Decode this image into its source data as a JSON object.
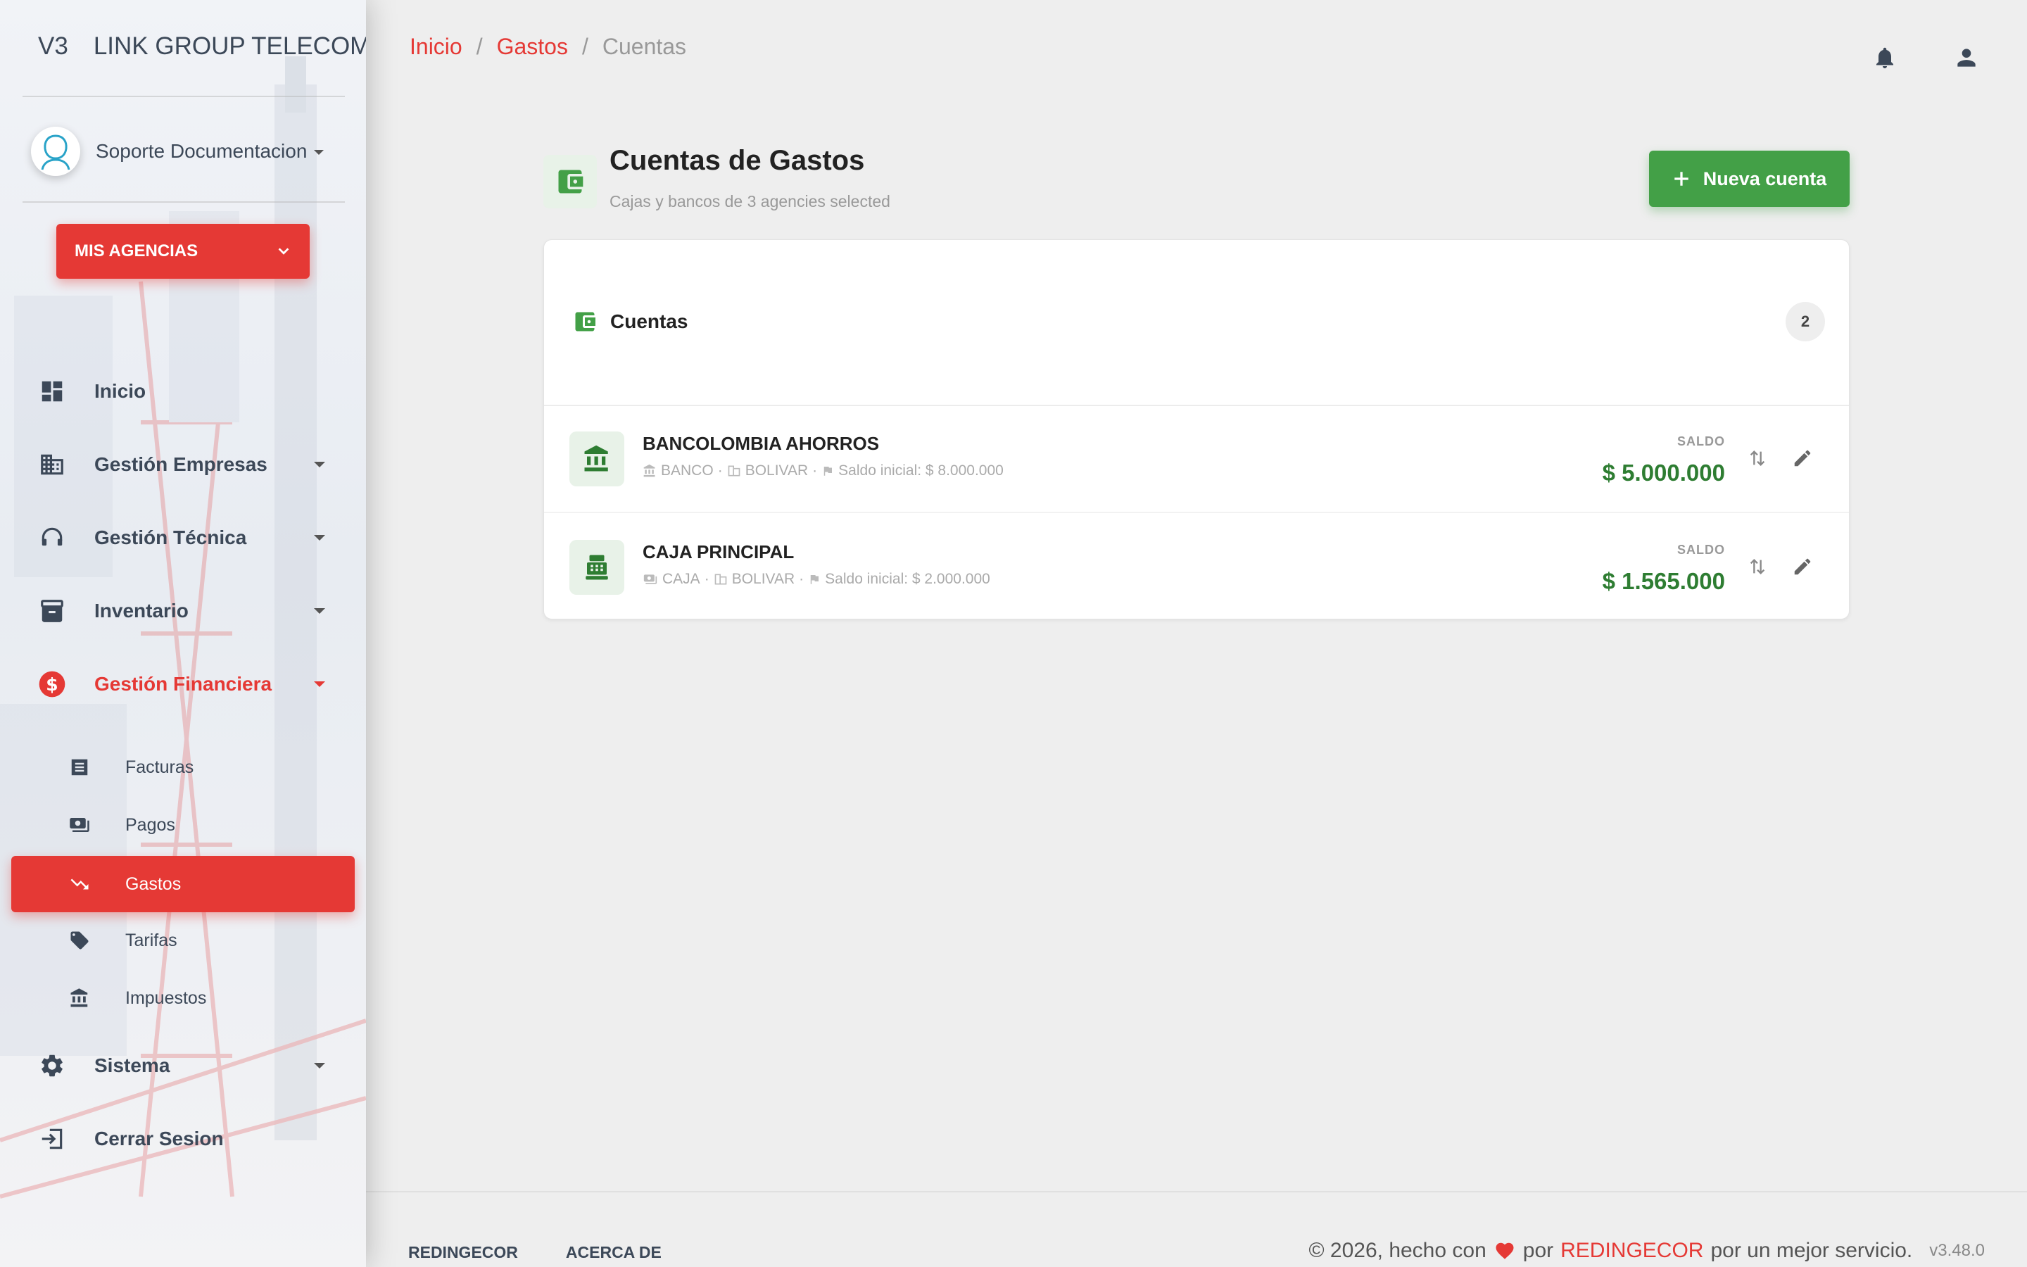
{
  "sidebar": {
    "logo_short": "V3",
    "logo_brand": "LINK GROUP TELECOMUNICACIONES",
    "user_name": "Soporte Documentacion",
    "agencies_label": "MIS AGENCIAS",
    "nav": [
      {
        "label": "Inicio",
        "icon": "dashboard-icon"
      },
      {
        "label": "Gestión Empresas",
        "icon": "building-icon"
      },
      {
        "label": "Gestión Técnica",
        "icon": "headset-icon"
      },
      {
        "label": "Inventario",
        "icon": "archive-icon"
      },
      {
        "label": "Gestión Financiera",
        "icon": "dollar-icon"
      },
      {
        "label": "Sistema",
        "icon": "gear-icon"
      },
      {
        "label": "Cerrar Sesion",
        "icon": "logout-icon"
      }
    ],
    "sub": [
      {
        "label": "Facturas",
        "icon": "invoice-icon"
      },
      {
        "label": "Pagos",
        "icon": "cash-icon"
      },
      {
        "label": "Gastos",
        "icon": "trending-down-icon"
      },
      {
        "label": "Tarifas",
        "icon": "tag-icon"
      },
      {
        "label": "Impuestos",
        "icon": "bank-icon"
      }
    ]
  },
  "breadcrumb": {
    "items": [
      "Inicio",
      "Gastos",
      "Cuentas"
    ],
    "separator": "/"
  },
  "header": {
    "title": "Cuentas de Gastos",
    "subtitle": "Cajas y bancos de 3 agencies selected",
    "new_button_label": "Nueva cuenta"
  },
  "card": {
    "title": "Cuentas",
    "count": "2",
    "saldo_label": "SALDO",
    "accounts": [
      {
        "name": "BANCOLOMBIA AHORROS",
        "type": "BANCO",
        "agency": "BOLIVAR",
        "initial": "Saldo inicial: $ 8.000.000",
        "balance": "$ 5.000.000"
      },
      {
        "name": "CAJA PRINCIPAL",
        "type": "CAJA",
        "agency": "BOLIVAR",
        "initial": "Saldo inicial: $ 2.000.000",
        "balance": "$ 1.565.000"
      }
    ]
  },
  "footer": {
    "links": [
      "REDINGECOR",
      "ACERCA DE"
    ],
    "copyright_prefix": "© 2026, hecho con",
    "copyright_by": "por",
    "brand": "REDINGECOR",
    "copyright_suffix": "por un mejor servicio.",
    "version": "v3.48.0"
  },
  "colors": {
    "accent_red": "#e53935",
    "accent_green": "#43a047",
    "balance_green": "#2e7d32"
  }
}
